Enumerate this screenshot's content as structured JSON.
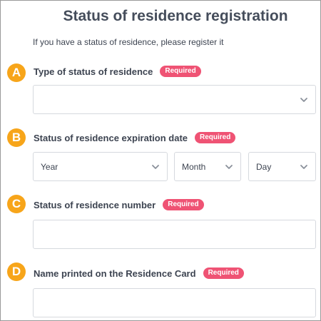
{
  "page": {
    "title": "Status of residence registration",
    "intro": "If you have a status of residence, please register it"
  },
  "required_badge": "Required",
  "sections": {
    "a": {
      "marker": "A",
      "label": "Type of status of residence",
      "value": ""
    },
    "b": {
      "marker": "B",
      "label": "Status of residence expiration date",
      "year": "Year",
      "month": "Month",
      "day": "Day"
    },
    "c": {
      "marker": "C",
      "label": "Status of residence number",
      "value": ""
    },
    "d": {
      "marker": "D",
      "label": "Name printed on the Residence Card",
      "value": ""
    }
  },
  "colors": {
    "marker": "#f7a51a",
    "badge": "#ef5374",
    "border": "#d6d9de"
  },
  "icons": {
    "dropdown": "chevron-down-icon"
  }
}
